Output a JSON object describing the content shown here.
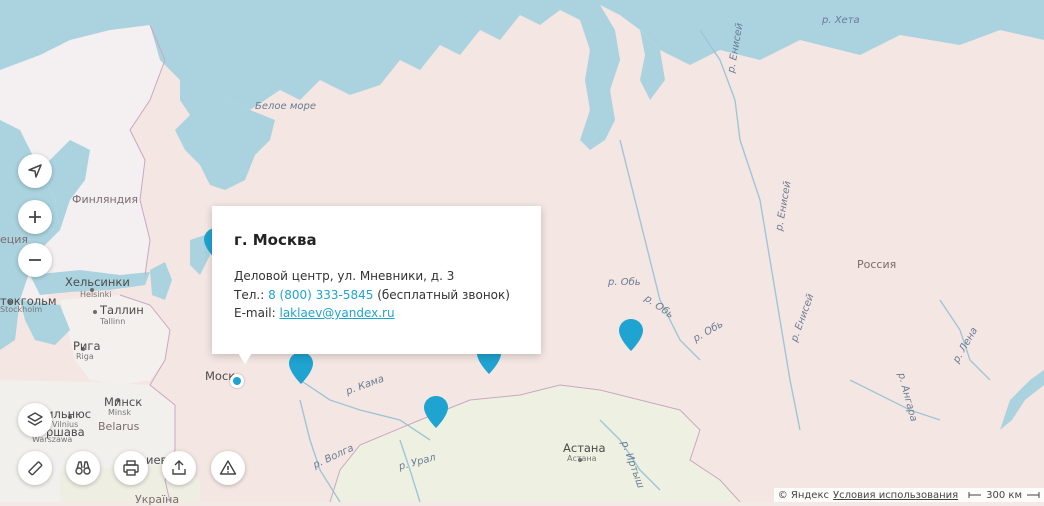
{
  "map": {
    "labels": {
      "white_sea": "Белое море",
      "river_kheta": "р. Хета",
      "river_yenisei_1": "р. Енисей",
      "river_yenisei_2": "р. Енисей",
      "river_yenisei_3": "р. Енисей",
      "river_ob_1": "р. Обь",
      "river_ob_2": "р. Обь",
      "river_ob_3": "р. Обь",
      "river_kama": "р. Кама",
      "river_volga": "р. Волга",
      "river_ural": "р. Урал",
      "river_irtysh": "р. Иртыш",
      "river_angara": "р. Ангара",
      "river_lena": "р. Лена",
      "finland": "Финляндия",
      "sweden": "еция",
      "russia": "Россия",
      "belarus": "Belarus",
      "helsinki": "Хельсинки",
      "helsinki_en": "Helsinki",
      "stockholm": "токгольм",
      "stockholm_en": "Stockholm",
      "tallinn": "Таллин",
      "tallinn_en": "Tallinn",
      "riga": "Рига",
      "riga_en": "Riga",
      "minsk": "Минск",
      "minsk_en": "Мinsk",
      "vilnius": "ильнюс",
      "vilnius_en": "Vilnius",
      "warsaw": "ршава",
      "warsaw_en": "Warszawa",
      "moscow": "Моск",
      "astana": "Астана",
      "astana_en": "Астана",
      "kiev_fragment": "иев",
      "ukraine_fragment": "Україна"
    }
  },
  "popup": {
    "title": "г. Москва",
    "address": "Деловой центр, ул. Мневники, д. 3",
    "phone_label": "Тел.: ",
    "phone": "8 (800) 333-5845",
    "phone_note": " (бесплатный звонок)",
    "email_label": "E-mail: ",
    "email": "laklaev@yandex.ru"
  },
  "footer": {
    "copyright": "© Яндекс",
    "terms": "Условия использования",
    "scale": "300 км"
  },
  "icons": {
    "geolocate": "location-arrow-icon",
    "zoom_in": "plus-icon",
    "zoom_out": "minus-icon",
    "layers": "layers-icon",
    "ruler": "ruler-icon",
    "panorama": "binoculars-icon",
    "print": "printer-icon",
    "share": "share-icon",
    "report": "warning-icon"
  },
  "colors": {
    "water": "#aad3df",
    "land_russia": "#f5e6e3",
    "land_other": "#f1f1e4",
    "marker": "#1fa3d1"
  }
}
